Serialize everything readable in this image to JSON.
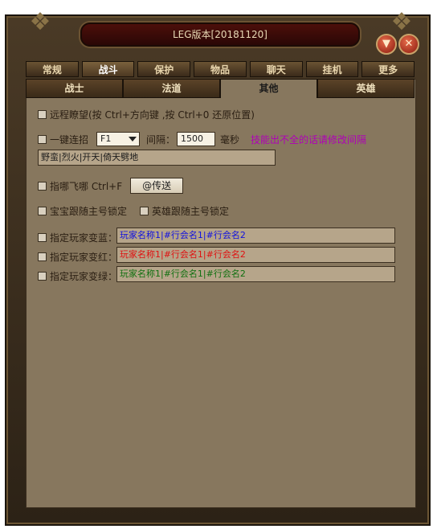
{
  "window": {
    "title": "LEG版本[20181120]"
  },
  "tabs_top": [
    {
      "label": "常规"
    },
    {
      "label": "战斗"
    },
    {
      "label": "保护"
    },
    {
      "label": "物品"
    },
    {
      "label": "聊天"
    },
    {
      "label": "挂机"
    },
    {
      "label": "更多"
    }
  ],
  "tabs_sub": [
    {
      "label": "战士"
    },
    {
      "label": "法道"
    },
    {
      "label": "其他"
    },
    {
      "label": "英雄"
    }
  ],
  "options": {
    "remote_view": "远程瞭望(按 Ctrl+方向键 ,按 Ctrl+0 还原位置)",
    "one_key": {
      "label": "一键连招",
      "select_value": "F1",
      "interval_label": "间隔：",
      "interval_value": "1500",
      "ms_label": "毫秒",
      "hint": "技能出不全的话请修改间隔",
      "combo_text": "野蛮|烈火|开天|倚天劈地"
    },
    "teleport": {
      "label": "指哪飞哪 Ctrl+F",
      "button": "@传送"
    },
    "pet_lock": "宝宝跟随主号锁定",
    "hero_lock": "英雄跟随主号锁定",
    "blue": {
      "label": "指定玩家变蓝：",
      "value": "玩家名称1|#行会名1|#行会名2"
    },
    "red": {
      "label": "指定玩家变红：",
      "value": "玩家名称1|#行会名1|#行会名2"
    },
    "green": {
      "label": "指定玩家变绿：",
      "value": "玩家名称1|#行会名1|#行会名2"
    }
  },
  "colors": {
    "blue": "#1010e0",
    "red": "#e01010",
    "green": "#107010",
    "hint": "#b000b8"
  },
  "icons": {
    "minimize": "chevron-down-icon",
    "close": "close-icon"
  }
}
